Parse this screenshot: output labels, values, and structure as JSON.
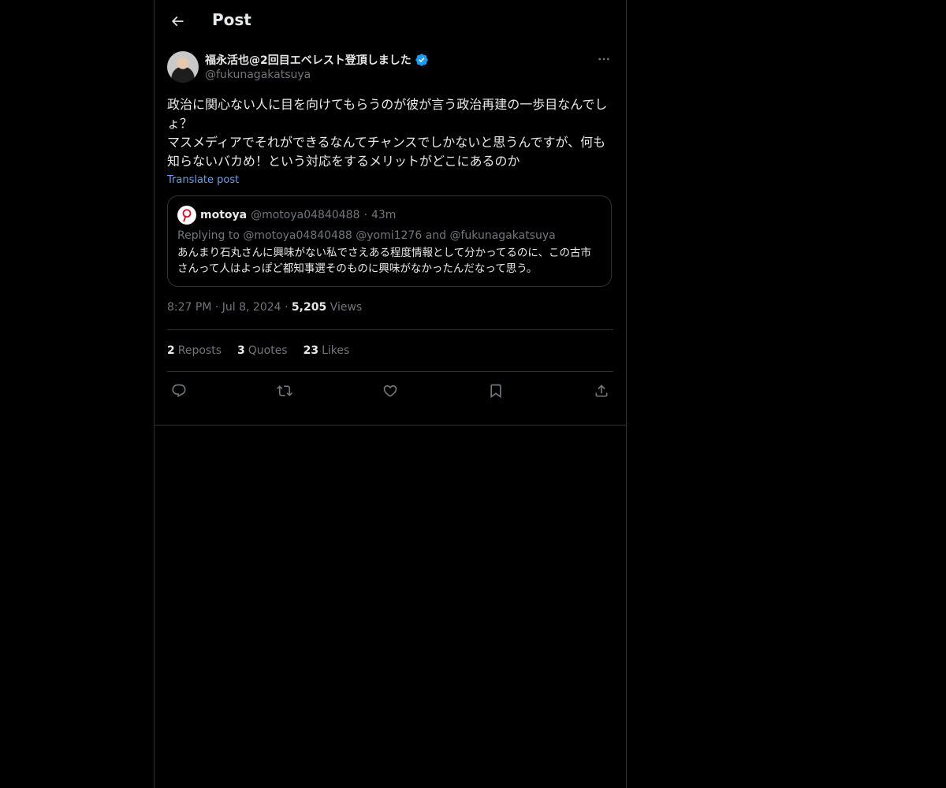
{
  "header": {
    "title": "Post"
  },
  "post": {
    "author_name": "福永活也@2回目エベレスト登頂しました",
    "author_handle": "@fukunagakatsuya",
    "text": "政治に関心ない人に目を向けてもらうのが彼が言う政治再建の一歩目なんでしょ？\nマスメディアでそれができるなんてチャンスでしかないと思うんですが、何も知らないバカめ！という対応をするメリットがどこにあるのか",
    "translate_label": "Translate post",
    "time": "8:27 PM",
    "date": "Jul 8, 2024",
    "views_count": "5,205",
    "views_label": "Views"
  },
  "quote": {
    "name": "motoya",
    "handle": "@motoya04840488",
    "separator": "·",
    "time": "43m",
    "reply_prefix": "Replying to",
    "reply_user1": "@motoya04840488",
    "reply_user2": "@yomi1276",
    "reply_and": "and",
    "reply_user3": "@fukunagakatsuya",
    "text": "あんまり石丸さんに興味がない私でさえある程度情報として分かってるのに、この古市さんって人はよっぽど都知事選そのものに興味がなかったんだなって思う。"
  },
  "stats": {
    "reposts_count": "2",
    "reposts_label": "Reposts",
    "quotes_count": "3",
    "quotes_label": "Quotes",
    "likes_count": "23",
    "likes_label": "Likes"
  },
  "icons": {
    "back": "arrow-left-icon",
    "verified": "verified-badge-icon",
    "more": "more-horizontal-icon",
    "reply": "reply-icon",
    "repost": "repost-icon",
    "like": "heart-icon",
    "bookmark": "bookmark-icon",
    "share": "share-icon"
  },
  "colors": {
    "background": "#000000",
    "text": "#e7e9ea",
    "muted": "#71767b",
    "link": "#6b9fe8",
    "verified": "#1d9bf0",
    "border": "#2f3336"
  }
}
